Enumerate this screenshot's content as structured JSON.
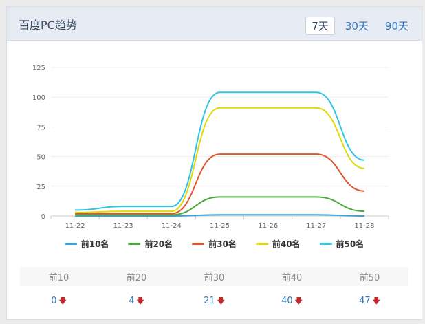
{
  "panel": {
    "title": "百度PC趋势",
    "tabs": [
      {
        "label": "7天",
        "active": true
      },
      {
        "label": "30天",
        "active": false
      },
      {
        "label": "90天",
        "active": false
      }
    ]
  },
  "chart_data": {
    "type": "line",
    "categories": [
      "11-22",
      "11-23",
      "11-24",
      "11-25",
      "11-26",
      "11-27",
      "11-28"
    ],
    "ylim": [
      0,
      125
    ],
    "yticks": [
      "0",
      "25",
      "50",
      "75",
      "100",
      "125"
    ],
    "grid": true,
    "legend_position": "bottom",
    "series": [
      {
        "name": "前10名",
        "color": "#33a3dc",
        "values": [
          0,
          0,
          0,
          1,
          1,
          1,
          0
        ]
      },
      {
        "name": "前20名",
        "color": "#4aaa3a",
        "values": [
          1,
          1,
          1,
          16,
          16,
          16,
          4
        ]
      },
      {
        "name": "前30名",
        "color": "#e4542a",
        "values": [
          2,
          2,
          2,
          52,
          52,
          52,
          21
        ]
      },
      {
        "name": "前40名",
        "color": "#e1d808",
        "values": [
          3,
          4,
          4,
          91,
          91,
          91,
          40
        ]
      },
      {
        "name": "前50名",
        "color": "#2ec4e6",
        "values": [
          5,
          8,
          8,
          104,
          104,
          104,
          47
        ]
      }
    ]
  },
  "stats": {
    "headers": [
      "前10",
      "前20",
      "前30",
      "前40",
      "前50"
    ],
    "values": [
      "0",
      "4",
      "21",
      "40",
      "47"
    ],
    "arrow": "🡇"
  }
}
